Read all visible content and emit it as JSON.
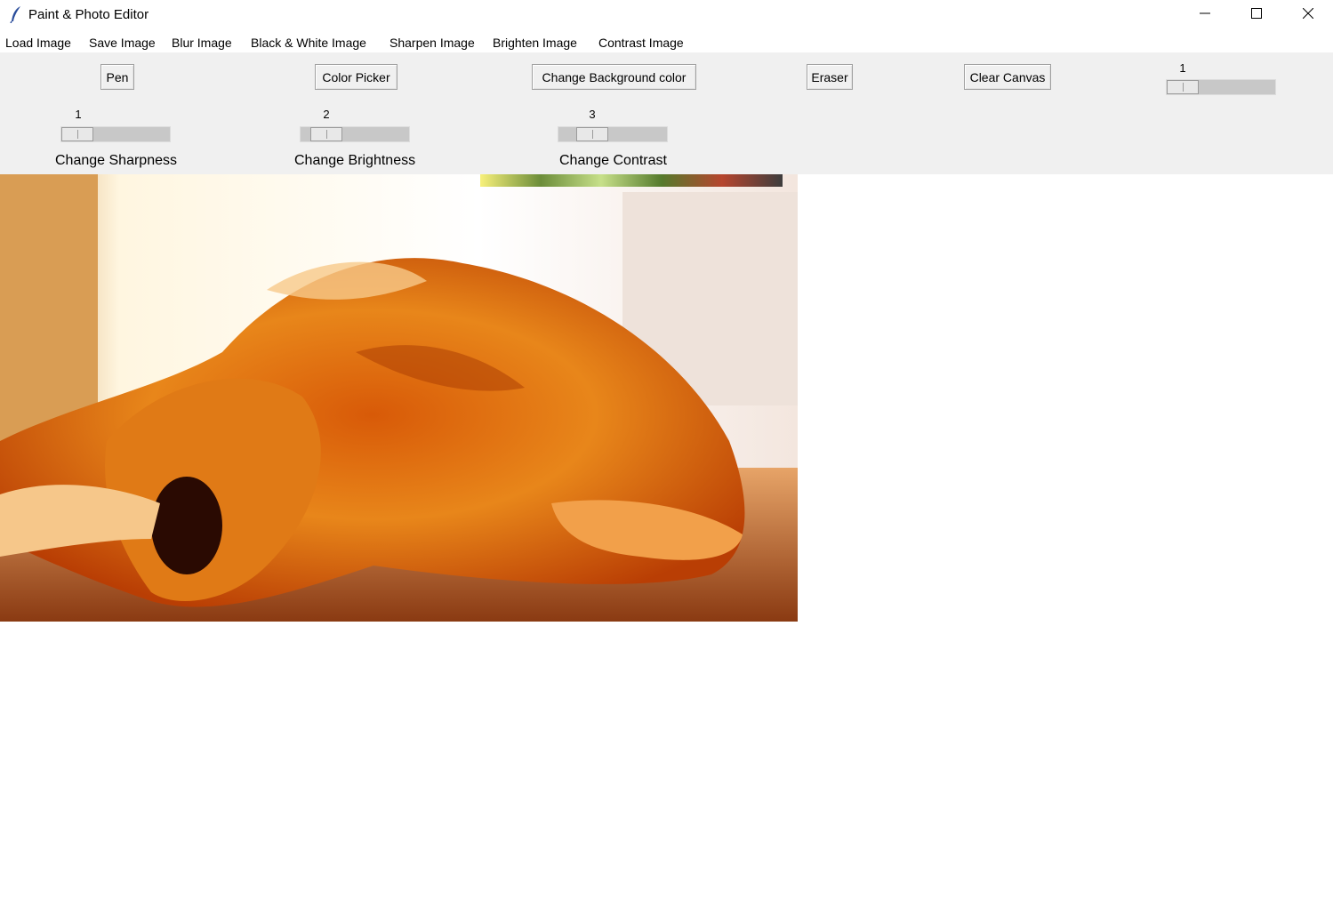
{
  "window": {
    "title": "Paint & Photo Editor",
    "app_icon": "feather-icon",
    "controls": [
      "minimize-icon",
      "maximize-icon",
      "close-icon"
    ]
  },
  "menu": {
    "items": [
      "Load Image",
      "Save Image",
      "Blur Image",
      "Black & White Image",
      "Sharpen Image",
      "Brighten Image",
      "Contrast Image"
    ]
  },
  "toolbar": {
    "pen": "Pen",
    "color_picker": "Color Picker",
    "change_bg": "Change Background color",
    "eraser": "Eraser",
    "clear_canvas": "Clear Canvas",
    "pen_size": {
      "value": "1"
    }
  },
  "scales": {
    "sharpness": {
      "value": "1",
      "label": "Change Sharpness"
    },
    "brightness": {
      "value": "2",
      "label": "Change Brightness"
    },
    "contrast": {
      "value": "3",
      "label": "Change Contrast"
    }
  },
  "canvas": {
    "image": "golden-retriever-sleeping-photo",
    "background": "#ffffff"
  }
}
